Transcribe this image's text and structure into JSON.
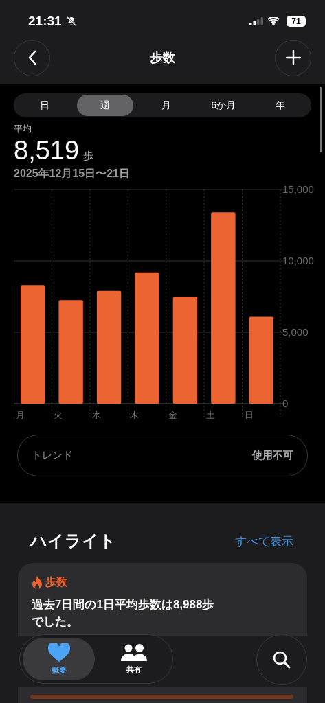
{
  "status_bar": {
    "time": "21:31",
    "battery": "71"
  },
  "nav": {
    "title": "歩数"
  },
  "segments": [
    {
      "label": "日",
      "selected": false
    },
    {
      "label": "週",
      "selected": true
    },
    {
      "label": "月",
      "selected": false
    },
    {
      "label": "6か月",
      "selected": false
    },
    {
      "label": "年",
      "selected": false
    }
  ],
  "summary": {
    "label": "平均",
    "value": "8,519",
    "unit": "歩",
    "range": "2025年12月15日〜21日"
  },
  "chart_data": {
    "type": "bar",
    "categories": [
      "月",
      "火",
      "水",
      "木",
      "金",
      "土",
      "日"
    ],
    "series": [
      {
        "color": "#ec6431",
        "values": [
          8300,
          7250,
          7900,
          9200,
          7500,
          13400,
          6080
        ]
      }
    ],
    "ylim": [
      0,
      15000
    ],
    "yticks": [
      {
        "value": 0,
        "label": "0"
      },
      {
        "value": 5000,
        "label": "5,000"
      },
      {
        "value": 10000,
        "label": "10,000"
      },
      {
        "value": 15000,
        "label": "15,000"
      }
    ]
  },
  "trend": {
    "label": "トレンド",
    "value": "使用不可"
  },
  "highlights": {
    "title": "ハイライト",
    "link": "すべて表示",
    "card": {
      "category": "歩数",
      "text": "過去7日間の1日平均歩数は8,988歩でした。"
    }
  },
  "tab_bar": [
    {
      "label": "概要",
      "kind": "heart",
      "selected": true
    },
    {
      "label": "共有",
      "kind": "people",
      "selected": false
    }
  ]
}
